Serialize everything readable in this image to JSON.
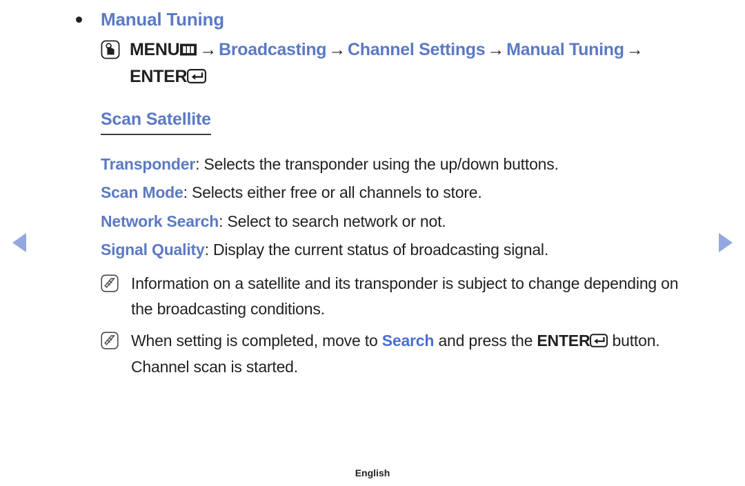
{
  "document": {
    "language_footer": "English"
  },
  "nav": {
    "prev_label": "previous page",
    "next_label": "next page"
  },
  "section": {
    "bullet_title": "Manual Tuning",
    "breadcrumb": {
      "press_icon": "hand-press-icon",
      "menu_label": "MENU",
      "menu_icon": "menu-bars-icon",
      "arrow": "→",
      "items": [
        {
          "label": "Broadcasting"
        },
        {
          "label": "Channel Settings"
        },
        {
          "label": "Manual Tuning"
        }
      ],
      "enter_label": "ENTER",
      "enter_icon": "enter-return-icon"
    },
    "sub_heading": "Scan Satellite",
    "options": [
      {
        "name": "Transponder",
        "separator": ": ",
        "description": "Selects the transponder using the up/down buttons."
      },
      {
        "name": "Scan Mode",
        "separator": ": ",
        "description": "Selects either free or all channels to store."
      },
      {
        "name": "Network Search",
        "separator": ": ",
        "description": "Select to search network or not."
      },
      {
        "name": "Signal Quality",
        "separator": ": ",
        "description": "Display the current status of broadcasting signal."
      }
    ],
    "notes": [
      {
        "icon": "note-pencil-icon",
        "text_before": "Information on a satellite and its transponder is subject to change depending on the broadcasting conditions.",
        "highlight": "",
        "text_middle": "",
        "keyword": "",
        "text_after": ""
      },
      {
        "icon": "note-pencil-icon",
        "text_before": "When setting is completed, move to ",
        "highlight": "Search",
        "text_middle": " and press the ",
        "keyword": "ENTER",
        "text_after": " button. Channel scan is started."
      }
    ]
  },
  "colors": {
    "heading_blue": "#5b79c4",
    "highlight_blue": "#4a6fd4",
    "body_text": "#231f20",
    "arrow_blue": "#93a8de",
    "underline": "#3a3a3a"
  }
}
